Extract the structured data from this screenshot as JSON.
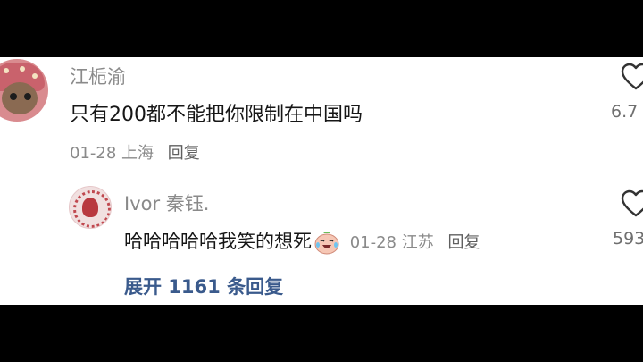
{
  "comment": {
    "username": "江栀渝",
    "text": "只有200都不能把你限制在中国吗",
    "date": "01-28",
    "location": "上海",
    "reply_label": "回复",
    "likes": "6.7"
  },
  "reply": {
    "username": "Ivor 秦钰.",
    "text": "哈哈哈哈哈我笑的想死",
    "date": "01-28",
    "location": "江苏",
    "reply_label": "回复",
    "likes": "593"
  },
  "expand_label": "展开 1161 条回复",
  "icons": [
    "heart-outline-icon",
    "laugh-cry-emoji"
  ]
}
